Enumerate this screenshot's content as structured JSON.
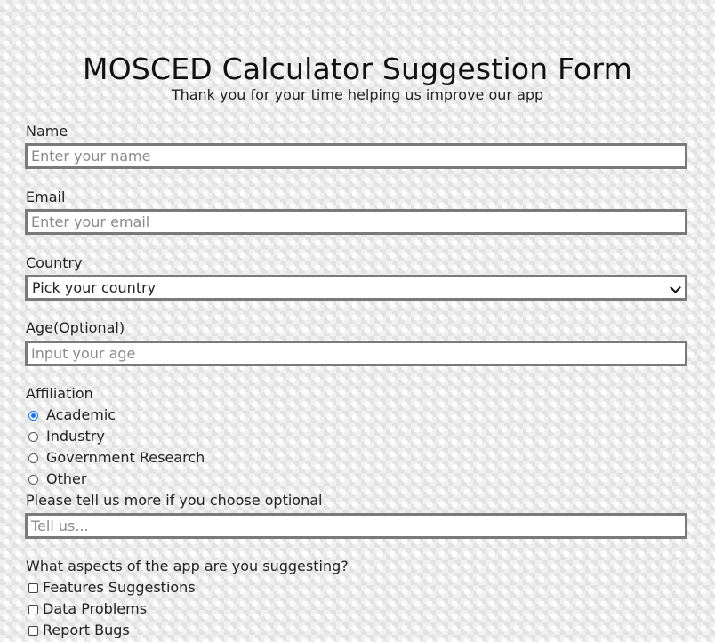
{
  "header": {
    "title": "MOSCED Calculator Suggestion Form",
    "subtitle": "Thank you for your time helping us improve our app"
  },
  "form": {
    "name": {
      "label": "Name",
      "placeholder": "Enter your name",
      "value": ""
    },
    "email": {
      "label": "Email",
      "placeholder": "Enter your email",
      "value": ""
    },
    "country": {
      "label": "Country",
      "selected": "Pick your country"
    },
    "age": {
      "label": "Age(Optional)",
      "placeholder": "Input your age",
      "value": ""
    },
    "affiliation": {
      "label": "Affiliation",
      "options": [
        {
          "label": "Academic",
          "checked": true
        },
        {
          "label": "Industry",
          "checked": false
        },
        {
          "label": "Government Research",
          "checked": false
        },
        {
          "label": "Other",
          "checked": false
        }
      ]
    },
    "more": {
      "label": "Please tell us more if you choose optional",
      "placeholder": "Tell us...",
      "value": ""
    },
    "aspects": {
      "label": "What aspects of the app are you suggesting?",
      "options": [
        {
          "label": "Features Suggestions",
          "checked": false
        },
        {
          "label": "Data Problems",
          "checked": false
        },
        {
          "label": "Report Bugs",
          "checked": false
        }
      ]
    }
  },
  "colors": {
    "radio_checked": "#1a73e8",
    "field_border": "#7a7a7a"
  }
}
